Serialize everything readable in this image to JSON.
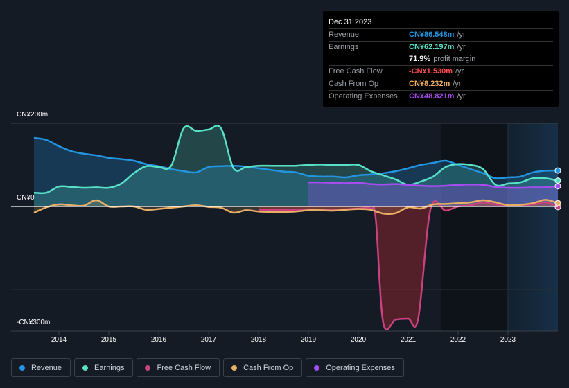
{
  "tooltip": {
    "date": "Dec 31 2023",
    "rows": [
      {
        "label": "Revenue",
        "value": "CN¥86.548m",
        "unit": "/yr",
        "color": "#2394df"
      },
      {
        "label": "Earnings",
        "value": "CN¥62.197m",
        "unit": "/yr",
        "color": "#58e1c8"
      },
      {
        "label": "",
        "value": "71.9%",
        "unit": "profit margin",
        "color": "#ffffff"
      },
      {
        "label": "Free Cash Flow",
        "value": "-CN¥1.530m",
        "unit": "/yr",
        "color": "#ff4d4d"
      },
      {
        "label": "Cash From Op",
        "value": "CN¥8.232m",
        "unit": "/yr",
        "color": "#f0b060"
      },
      {
        "label": "Operating Expenses",
        "value": "CN¥48.821m",
        "unit": "/yr",
        "color": "#a64df0"
      }
    ]
  },
  "legend": [
    {
      "label": "Revenue",
      "color": "#2394df"
    },
    {
      "label": "Earnings",
      "color": "#58e1c8"
    },
    {
      "label": "Free Cash Flow",
      "color": "#c8437f"
    },
    {
      "label": "Cash From Op",
      "color": "#e8ae65"
    },
    {
      "label": "Operating Expenses",
      "color": "#a64df0"
    }
  ],
  "chart_data": {
    "type": "area",
    "title": "",
    "xlabel": "",
    "ylabel": "",
    "currency": "CNY",
    "y_tick_labels": [
      "CN¥200m",
      "CN¥0",
      "-CN¥300m"
    ],
    "y_ticks": [
      200,
      0,
      -300
    ],
    "ylim": [
      -300,
      200
    ],
    "xlim": [
      2013.5,
      2024.0
    ],
    "x_tick_labels": [
      "2014",
      "2015",
      "2016",
      "2017",
      "2018",
      "2019",
      "2020",
      "2021",
      "2022",
      "2023"
    ],
    "x_ticks": [
      2014,
      2015,
      2016,
      2017,
      2018,
      2019,
      2020,
      2021,
      2022,
      2023
    ],
    "forecast_shade_start": 2023.0,
    "grid": true,
    "legend_position": "bottom-left",
    "series": [
      {
        "name": "Revenue",
        "color": "#2394df",
        "points": [
          [
            2013.5,
            165
          ],
          [
            2013.75,
            160
          ],
          [
            2014.0,
            145
          ],
          [
            2014.25,
            133
          ],
          [
            2014.5,
            127
          ],
          [
            2014.75,
            123
          ],
          [
            2015.0,
            117
          ],
          [
            2015.25,
            114
          ],
          [
            2015.5,
            110
          ],
          [
            2015.75,
            102
          ],
          [
            2016.0,
            97
          ],
          [
            2016.25,
            90
          ],
          [
            2016.5,
            85
          ],
          [
            2016.75,
            82
          ],
          [
            2017.0,
            95
          ],
          [
            2017.25,
            97
          ],
          [
            2017.5,
            98
          ],
          [
            2017.75,
            96
          ],
          [
            2018.0,
            92
          ],
          [
            2018.25,
            88
          ],
          [
            2018.5,
            84
          ],
          [
            2018.75,
            82
          ],
          [
            2019.0,
            74
          ],
          [
            2019.25,
            72
          ],
          [
            2019.5,
            72
          ],
          [
            2019.75,
            70
          ],
          [
            2020.0,
            75
          ],
          [
            2020.25,
            77
          ],
          [
            2020.5,
            80
          ],
          [
            2020.75,
            85
          ],
          [
            2021.0,
            92
          ],
          [
            2021.25,
            100
          ],
          [
            2021.5,
            105
          ],
          [
            2021.75,
            110
          ],
          [
            2022.0,
            100
          ],
          [
            2022.25,
            90
          ],
          [
            2022.5,
            80
          ],
          [
            2022.75,
            68
          ],
          [
            2023.0,
            70
          ],
          [
            2023.25,
            72
          ],
          [
            2023.5,
            82
          ],
          [
            2023.75,
            86
          ],
          [
            2024.0,
            86.5
          ]
        ]
      },
      {
        "name": "Earnings",
        "color": "#58e1c8",
        "points": [
          [
            2013.5,
            33
          ],
          [
            2013.75,
            33
          ],
          [
            2014.0,
            48
          ],
          [
            2014.25,
            47
          ],
          [
            2014.5,
            45
          ],
          [
            2014.75,
            46
          ],
          [
            2015.0,
            45
          ],
          [
            2015.25,
            55
          ],
          [
            2015.5,
            80
          ],
          [
            2015.75,
            97
          ],
          [
            2016.0,
            95
          ],
          [
            2016.25,
            98
          ],
          [
            2016.5,
            188
          ],
          [
            2016.75,
            182
          ],
          [
            2017.0,
            185
          ],
          [
            2017.25,
            188
          ],
          [
            2017.5,
            92
          ],
          [
            2017.75,
            95
          ],
          [
            2018.0,
            98
          ],
          [
            2018.25,
            98
          ],
          [
            2018.5,
            98
          ],
          [
            2018.75,
            98
          ],
          [
            2019.0,
            100
          ],
          [
            2019.25,
            101
          ],
          [
            2019.5,
            100
          ],
          [
            2019.75,
            100
          ],
          [
            2020.0,
            100
          ],
          [
            2020.25,
            85
          ],
          [
            2020.5,
            75
          ],
          [
            2020.75,
            65
          ],
          [
            2021.0,
            52
          ],
          [
            2021.25,
            60
          ],
          [
            2021.5,
            72
          ],
          [
            2021.75,
            95
          ],
          [
            2022.0,
            102
          ],
          [
            2022.25,
            100
          ],
          [
            2022.5,
            90
          ],
          [
            2022.75,
            52
          ],
          [
            2023.0,
            55
          ],
          [
            2023.25,
            58
          ],
          [
            2023.5,
            68
          ],
          [
            2023.75,
            68
          ],
          [
            2024.0,
            62.2
          ]
        ]
      },
      {
        "name": "Free Cash Flow",
        "color": "#c8437f",
        "points": [
          [
            2018.0,
            -8
          ],
          [
            2018.5,
            -8
          ],
          [
            2019.0,
            -8
          ],
          [
            2019.5,
            -8
          ],
          [
            2020.0,
            -5
          ],
          [
            2020.25,
            -5
          ],
          [
            2020.35,
            -30
          ],
          [
            2020.5,
            -280
          ],
          [
            2020.75,
            -272
          ],
          [
            2021.0,
            -270
          ],
          [
            2021.2,
            -270
          ],
          [
            2021.45,
            -5
          ],
          [
            2021.75,
            -10
          ],
          [
            2022.0,
            0
          ],
          [
            2022.25,
            3
          ],
          [
            2022.5,
            10
          ],
          [
            2022.75,
            5
          ],
          [
            2023.0,
            2
          ],
          [
            2023.25,
            3
          ],
          [
            2023.5,
            5
          ],
          [
            2023.75,
            10
          ],
          [
            2024.0,
            -1.5
          ]
        ]
      },
      {
        "name": "Cash From Op",
        "color": "#e8ae65",
        "points": [
          [
            2013.5,
            -15
          ],
          [
            2013.75,
            -2
          ],
          [
            2014.0,
            5
          ],
          [
            2014.25,
            3
          ],
          [
            2014.5,
            2
          ],
          [
            2014.75,
            15
          ],
          [
            2015.0,
            0
          ],
          [
            2015.25,
            0
          ],
          [
            2015.5,
            0
          ],
          [
            2015.75,
            -8
          ],
          [
            2016.0,
            -6
          ],
          [
            2016.25,
            -3
          ],
          [
            2016.5,
            0
          ],
          [
            2016.75,
            3
          ],
          [
            2017.0,
            -1
          ],
          [
            2017.25,
            -3
          ],
          [
            2017.5,
            -15
          ],
          [
            2017.75,
            -9
          ],
          [
            2018.0,
            -12
          ],
          [
            2018.25,
            -13
          ],
          [
            2018.5,
            -13
          ],
          [
            2018.75,
            -12
          ],
          [
            2019.0,
            -9
          ],
          [
            2019.25,
            -9
          ],
          [
            2019.5,
            -10
          ],
          [
            2019.75,
            -8
          ],
          [
            2020.0,
            -6
          ],
          [
            2020.25,
            -8
          ],
          [
            2020.5,
            -17
          ],
          [
            2020.75,
            -16
          ],
          [
            2021.0,
            -2
          ],
          [
            2021.25,
            -5
          ],
          [
            2021.5,
            5
          ],
          [
            2021.75,
            6
          ],
          [
            2022.0,
            8
          ],
          [
            2022.25,
            10
          ],
          [
            2022.5,
            15
          ],
          [
            2022.75,
            10
          ],
          [
            2023.0,
            3
          ],
          [
            2023.25,
            4
          ],
          [
            2023.5,
            8
          ],
          [
            2023.75,
            16
          ],
          [
            2024.0,
            8.2
          ]
        ]
      },
      {
        "name": "Operating Expenses",
        "color": "#a64df0",
        "points": [
          [
            2019.0,
            58
          ],
          [
            2019.25,
            58
          ],
          [
            2019.5,
            57
          ],
          [
            2019.75,
            56
          ],
          [
            2020.0,
            57
          ],
          [
            2020.25,
            54
          ],
          [
            2020.5,
            53
          ],
          [
            2020.75,
            54
          ],
          [
            2021.0,
            52
          ],
          [
            2021.25,
            50
          ],
          [
            2021.5,
            49
          ],
          [
            2021.75,
            50
          ],
          [
            2022.0,
            52
          ],
          [
            2022.25,
            53
          ],
          [
            2022.5,
            52
          ],
          [
            2022.75,
            47
          ],
          [
            2023.0,
            45
          ],
          [
            2023.25,
            45
          ],
          [
            2023.5,
            46
          ],
          [
            2023.75,
            46
          ],
          [
            2024.0,
            48.8
          ]
        ]
      }
    ]
  }
}
